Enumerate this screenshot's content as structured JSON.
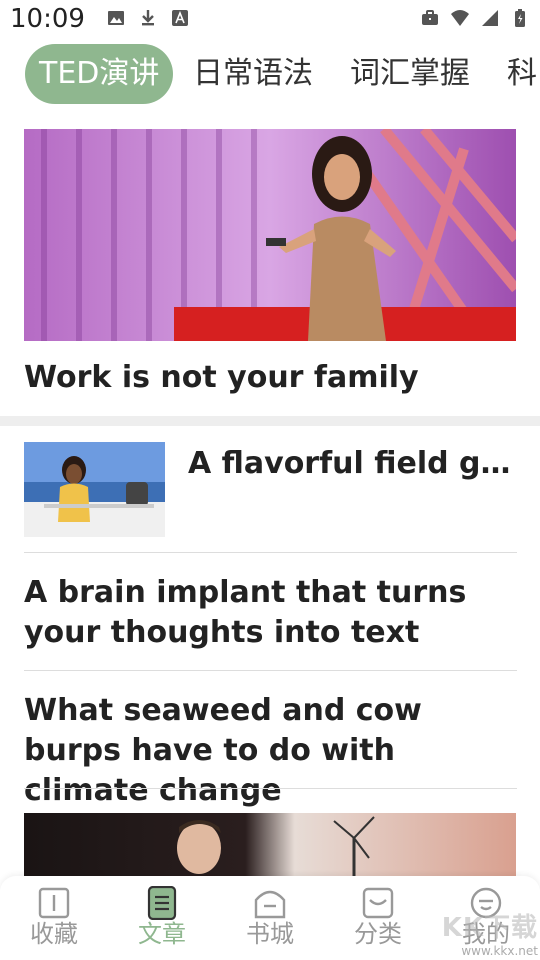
{
  "status_bar": {
    "time": "10:09",
    "left_icons": [
      "image-icon",
      "download-icon",
      "text-icon"
    ],
    "right_icons": [
      "briefcase-icon",
      "wifi-icon",
      "signal-icon",
      "battery-icon"
    ]
  },
  "tabs": [
    {
      "label": "TED演讲",
      "active": true
    },
    {
      "label": "日常语法",
      "active": false
    },
    {
      "label": "词汇掌握",
      "active": false
    },
    {
      "label": "科",
      "active": false
    }
  ],
  "featured": {
    "title": "Work is not your family"
  },
  "list": [
    {
      "title": "A flavorful field guid…"
    },
    {
      "title": "A brain implant that turns your thoughts into text"
    },
    {
      "title": "What seaweed and cow burps have to do with climate change"
    }
  ],
  "bottom_nav": [
    {
      "label": "收藏",
      "icon": "book-icon",
      "active": false
    },
    {
      "label": "文章",
      "icon": "article-icon",
      "active": true
    },
    {
      "label": "书城",
      "icon": "store-icon",
      "active": false
    },
    {
      "label": "分类",
      "icon": "category-icon",
      "active": false
    },
    {
      "label": "我的",
      "icon": "profile-icon",
      "active": false
    }
  ],
  "watermark": {
    "logo": "KK下载",
    "url": "www.kkx.net"
  },
  "colors": {
    "accent": "#8fb78f",
    "text": "#222222",
    "inactive": "#999999",
    "separator": "#eeeeee"
  }
}
